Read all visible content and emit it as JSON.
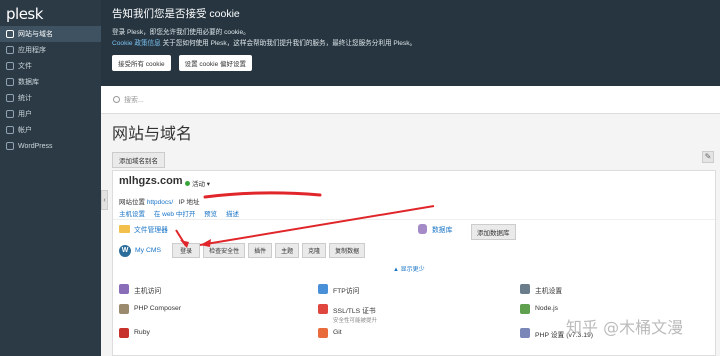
{
  "sidebar": {
    "logo": "plesk",
    "items": [
      {
        "label": "网站与域名",
        "active": true
      },
      {
        "label": "应用程序"
      },
      {
        "label": "文件"
      },
      {
        "label": "数据库"
      },
      {
        "label": "统计"
      },
      {
        "label": "用户"
      },
      {
        "label": "帐户"
      },
      {
        "label": "WordPress"
      }
    ]
  },
  "cookie_banner": {
    "title": "告知我们您是否接受 cookie",
    "line1": "登录 Plesk，即您允许我们使用必要的 cookie。",
    "policy_link": "Cookie 政策信息",
    "line2": "关于您如何使用 Plesk，这样会帮助我们提升我们的服务，最终让您服务分利用 Plesk。",
    "accept_all": "接受所有 cookie",
    "settings": "设置 cookie 偏好设置"
  },
  "search": {
    "placeholder": "搜索..."
  },
  "page": {
    "title": "网站与域名",
    "add_alias": "添加域名别名"
  },
  "domain": {
    "name": "mlhgzs.com",
    "status": "活动",
    "site_location_label": "网站位置",
    "site_location": "httpdocs/",
    "ip_label": "IP 地址",
    "links": [
      "主机设置",
      "在 web 中打开",
      "预览",
      "描述"
    ],
    "file_manager": "文件管理器",
    "databases": "数据库",
    "add_database": "添加数据库",
    "wp": {
      "label": "My CMS",
      "buttons": [
        "登录",
        "检查安全性",
        "插件",
        "主题",
        "克隆",
        "复制数据"
      ]
    },
    "show_less": "▲ 显示更少",
    "tools": [
      {
        "label": "主机访问",
        "sub": ""
      },
      {
        "label": "FTP访问",
        "sub": ""
      },
      {
        "label": "主机设置",
        "sub": ""
      },
      {
        "label": "PHP Composer",
        "sub": ""
      },
      {
        "label": "SSL/TLS 证书",
        "sub": "安全性可能被提升"
      },
      {
        "label": "Node.js",
        "sub": ""
      },
      {
        "label": "Ruby",
        "sub": ""
      },
      {
        "label": "Git",
        "sub": ""
      },
      {
        "label": "PHP 设置 (v7.3.19)",
        "sub": ""
      }
    ]
  },
  "watermark": "知乎 @木桶文漫",
  "colors": {
    "sidebar": "#2b3a45",
    "link": "#1a74c6",
    "annotation_arrow": "#e0262a"
  }
}
